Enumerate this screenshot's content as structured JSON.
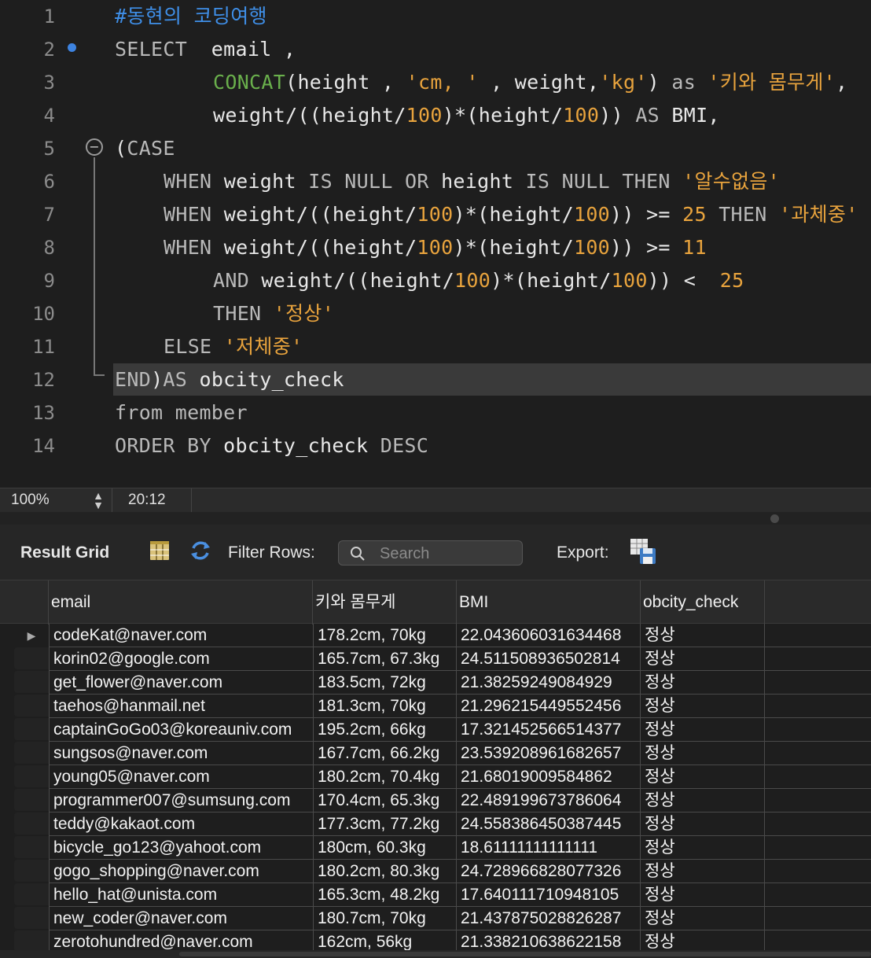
{
  "editor": {
    "lines": [
      {
        "num": "1",
        "indent": 146,
        "tokens": [
          {
            "t": "#동현의 코딩여행",
            "c": "cmt"
          }
        ]
      },
      {
        "num": "2",
        "indent": 146,
        "tokens": [
          {
            "t": "SELECT",
            "c": "kw"
          },
          {
            "t": "  email ,",
            "c": "plain"
          }
        ]
      },
      {
        "num": "3",
        "indent": 271,
        "tokens": [
          {
            "t": "CONCAT",
            "c": "fn"
          },
          {
            "t": "(height , ",
            "c": "plain"
          },
          {
            "t": "'cm, '",
            "c": "str"
          },
          {
            "t": " , weight,",
            "c": "plain"
          },
          {
            "t": "'kg'",
            "c": "str"
          },
          {
            "t": ") ",
            "c": "plain"
          },
          {
            "t": "as",
            "c": "kw"
          },
          {
            "t": " ",
            "c": "plain"
          },
          {
            "t": "'키와 몸무게'",
            "c": "str"
          },
          {
            "t": ",",
            "c": "plain"
          }
        ]
      },
      {
        "num": "4",
        "indent": 271,
        "tokens": [
          {
            "t": "weight/((height/",
            "c": "plain"
          },
          {
            "t": "100",
            "c": "num"
          },
          {
            "t": ")*(height/",
            "c": "plain"
          },
          {
            "t": "100",
            "c": "num"
          },
          {
            "t": ")) ",
            "c": "plain"
          },
          {
            "t": "AS",
            "c": "kw"
          },
          {
            "t": " BMI,",
            "c": "plain"
          }
        ]
      },
      {
        "num": "5",
        "indent": 146,
        "tokens": [
          {
            "t": "(",
            "c": "plain"
          },
          {
            "t": "CASE",
            "c": "kw"
          }
        ]
      },
      {
        "num": "6",
        "indent": 208,
        "tokens": [
          {
            "t": "WHEN",
            "c": "kw"
          },
          {
            "t": " weight ",
            "c": "plain"
          },
          {
            "t": "IS NULL OR",
            "c": "kw"
          },
          {
            "t": " height ",
            "c": "plain"
          },
          {
            "t": "IS NULL THEN",
            "c": "kw"
          },
          {
            "t": " ",
            "c": "plain"
          },
          {
            "t": "'알수없음'",
            "c": "str"
          }
        ]
      },
      {
        "num": "7",
        "indent": 208,
        "tokens": [
          {
            "t": "WHEN",
            "c": "kw"
          },
          {
            "t": " weight/((height/",
            "c": "plain"
          },
          {
            "t": "100",
            "c": "num"
          },
          {
            "t": ")*(height/",
            "c": "plain"
          },
          {
            "t": "100",
            "c": "num"
          },
          {
            "t": ")) >= ",
            "c": "plain"
          },
          {
            "t": "25",
            "c": "num"
          },
          {
            "t": " ",
            "c": "plain"
          },
          {
            "t": "THEN",
            "c": "kw"
          },
          {
            "t": " ",
            "c": "plain"
          },
          {
            "t": "'과체중'",
            "c": "str"
          }
        ]
      },
      {
        "num": "8",
        "indent": 208,
        "tokens": [
          {
            "t": "WHEN",
            "c": "kw"
          },
          {
            "t": " weight/((height/",
            "c": "plain"
          },
          {
            "t": "100",
            "c": "num"
          },
          {
            "t": ")*(height/",
            "c": "plain"
          },
          {
            "t": "100",
            "c": "num"
          },
          {
            "t": ")) >= ",
            "c": "plain"
          },
          {
            "t": "11",
            "c": "num"
          }
        ]
      },
      {
        "num": "9",
        "indent": 271,
        "tokens": [
          {
            "t": "AND",
            "c": "kw"
          },
          {
            "t": " weight/((height/",
            "c": "plain"
          },
          {
            "t": "100",
            "c": "num"
          },
          {
            "t": ")*(height/",
            "c": "plain"
          },
          {
            "t": "100",
            "c": "num"
          },
          {
            "t": ")) <  ",
            "c": "plain"
          },
          {
            "t": "25",
            "c": "num"
          }
        ]
      },
      {
        "num": "10",
        "indent": 271,
        "tokens": [
          {
            "t": "THEN",
            "c": "kw"
          },
          {
            "t": " ",
            "c": "plain"
          },
          {
            "t": "'정상'",
            "c": "str"
          }
        ]
      },
      {
        "num": "11",
        "indent": 208,
        "tokens": [
          {
            "t": "ELSE",
            "c": "kw"
          },
          {
            "t": " ",
            "c": "plain"
          },
          {
            "t": "'저체중'",
            "c": "str"
          }
        ]
      },
      {
        "num": "12",
        "indent": 146,
        "highlight": true,
        "tokens": [
          {
            "t": "END",
            "c": "kw"
          },
          {
            "t": ")",
            "c": "plain"
          },
          {
            "t": "AS",
            "c": "kw"
          },
          {
            "t": " obcity_check",
            "c": "plain"
          }
        ]
      },
      {
        "num": "13",
        "indent": 146,
        "tokens": [
          {
            "t": "from",
            "c": "kw"
          },
          {
            "t": " member",
            "c": "kw"
          }
        ]
      },
      {
        "num": "14",
        "indent": 146,
        "tokens": [
          {
            "t": "ORDER BY",
            "c": "kw"
          },
          {
            "t": " obcity_check ",
            "c": "plain"
          },
          {
            "t": "DESC",
            "c": "kw"
          }
        ]
      }
    ]
  },
  "status": {
    "zoom": "100%",
    "cursor": "20:12"
  },
  "toolbar": {
    "title": "Result Grid",
    "filter_label": "Filter Rows:",
    "search_placeholder": "Search",
    "export_label": "Export:"
  },
  "grid": {
    "columns": [
      "email",
      "키와 몸무게",
      "BMI",
      "obcity_check"
    ],
    "rows": [
      [
        "codeKat@naver.com",
        "178.2cm, 70kg",
        "22.043606031634468",
        "정상"
      ],
      [
        "korin02@google.com",
        "165.7cm, 67.3kg",
        "24.511508936502814",
        "정상"
      ],
      [
        "get_flower@naver.com",
        "183.5cm, 72kg",
        "21.38259249084929",
        "정상"
      ],
      [
        "taehos@hanmail.net",
        "181.3cm, 70kg",
        "21.296215449552456",
        "정상"
      ],
      [
        "captainGoGo03@koreauniv.com",
        "195.2cm, 66kg",
        "17.321452566514377",
        "정상"
      ],
      [
        "sungsos@naver.com",
        "167.7cm, 66.2kg",
        "23.539208961682657",
        "정상"
      ],
      [
        "young05@naver.com",
        "180.2cm, 70.4kg",
        "21.68019009584862",
        "정상"
      ],
      [
        "programmer007@sumsung.com",
        "170.4cm, 65.3kg",
        "22.489199673786064",
        "정상"
      ],
      [
        "teddy@kakaot.com",
        "177.3cm, 77.2kg",
        "24.558386450387445",
        "정상"
      ],
      [
        "bicycle_go123@yahoot.com",
        "180cm, 60.3kg",
        "18.61111111111111",
        "정상"
      ],
      [
        "gogo_shopping@naver.com",
        "180.2cm, 80.3kg",
        "24.728966828077326",
        "정상"
      ],
      [
        "hello_hat@unista.com",
        "165.3cm, 48.2kg",
        "17.640111710948105",
        "정상"
      ],
      [
        "new_coder@naver.com",
        "180.7cm, 70kg",
        "21.437875028826287",
        "정상"
      ],
      [
        "zerotohundred@naver.com",
        "162cm, 56kg",
        "21.338210638622158",
        "정상"
      ]
    ]
  }
}
